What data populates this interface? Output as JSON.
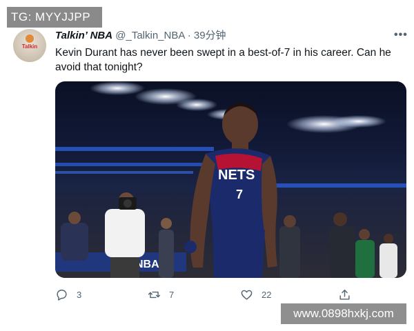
{
  "watermark_top": "TG: MYYJJPP",
  "watermark_bottom": "www.0898hxkj.com",
  "tweet": {
    "display_name": "Talkin’ NBA",
    "handle": "@_Talkin_NBA",
    "separator": "·",
    "time": "39分钟",
    "text": "Kevin Durant has never been swept in a best-of-7 in his career. Can he avoid that tonight?",
    "avatar_text": "Talkin"
  },
  "media": {
    "jersey_text": "NETS",
    "jersey_number": "7",
    "court_banner": "NBA75"
  },
  "actions": {
    "reply_count": "3",
    "retweet_count": "7",
    "like_count": "22"
  },
  "icons": {
    "reply": "reply-icon",
    "retweet": "retweet-icon",
    "like": "heart-icon",
    "share": "share-icon",
    "more": "more-icon"
  }
}
